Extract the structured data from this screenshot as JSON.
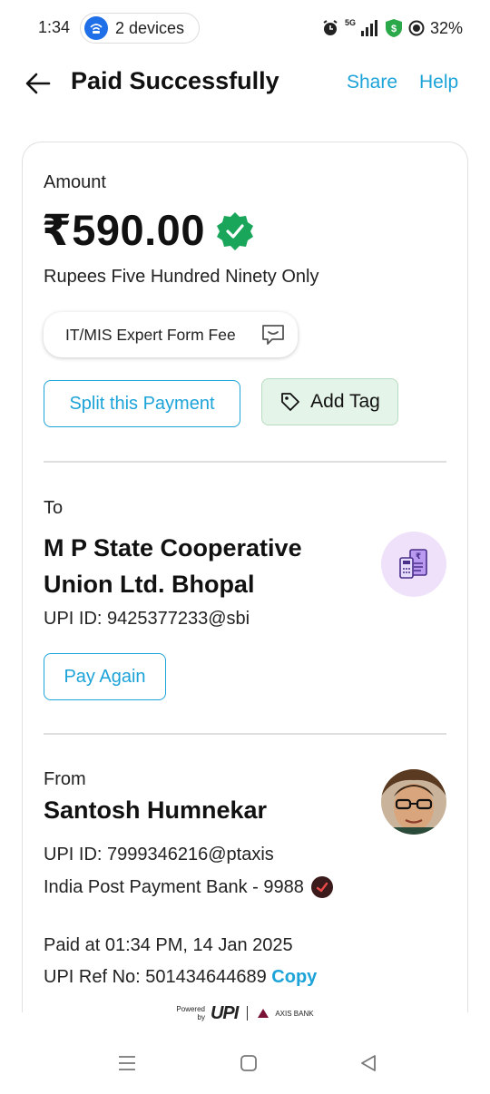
{
  "status_bar": {
    "time": "1:34",
    "devices_label": "2 devices",
    "network": "5G",
    "battery": "32%"
  },
  "header": {
    "title": "Paid Successfully",
    "share_label": "Share",
    "help_label": "Help"
  },
  "payment": {
    "amount_label": "Amount",
    "amount": "₹590.00",
    "amount_words": "Rupees Five Hundred Ninety Only",
    "note": "IT/MIS Expert Form Fee",
    "split_label": "Split this Payment",
    "add_tag_label": "Add Tag"
  },
  "payee": {
    "to_label": "To",
    "name": "M P State Cooperative Union Ltd. Bhopal",
    "upi_id": "UPI ID: 9425377233@sbi",
    "pay_again_label": "Pay Again"
  },
  "payer": {
    "from_label": "From",
    "name": "Santosh Humnekar",
    "upi_id": "UPI ID: 7999346216@ptaxis",
    "bank": "India Post Payment Bank - 9988"
  },
  "transaction": {
    "paid_at": "Paid at 01:34 PM, 14 Jan 2025",
    "ref_no": "UPI Ref No: 501434644689",
    "copy_label": "Copy"
  },
  "footer": {
    "powered_line1": "Powered",
    "powered_line2": "by",
    "upi_text": "UPI",
    "bank_text": "AXIS BANK"
  },
  "colors": {
    "accent": "#1ca3d8",
    "verified_green": "#19a55a",
    "tag_bg": "#e5f4e8",
    "payee_avatar_bg": "#efe1fa"
  },
  "icons": [
    "back-arrow-icon",
    "verified-check-icon",
    "message-icon",
    "tag-icon",
    "bill-icon",
    "devices-icon",
    "alarm-icon",
    "signal-icon",
    "shield-icon",
    "battery-icon"
  ]
}
